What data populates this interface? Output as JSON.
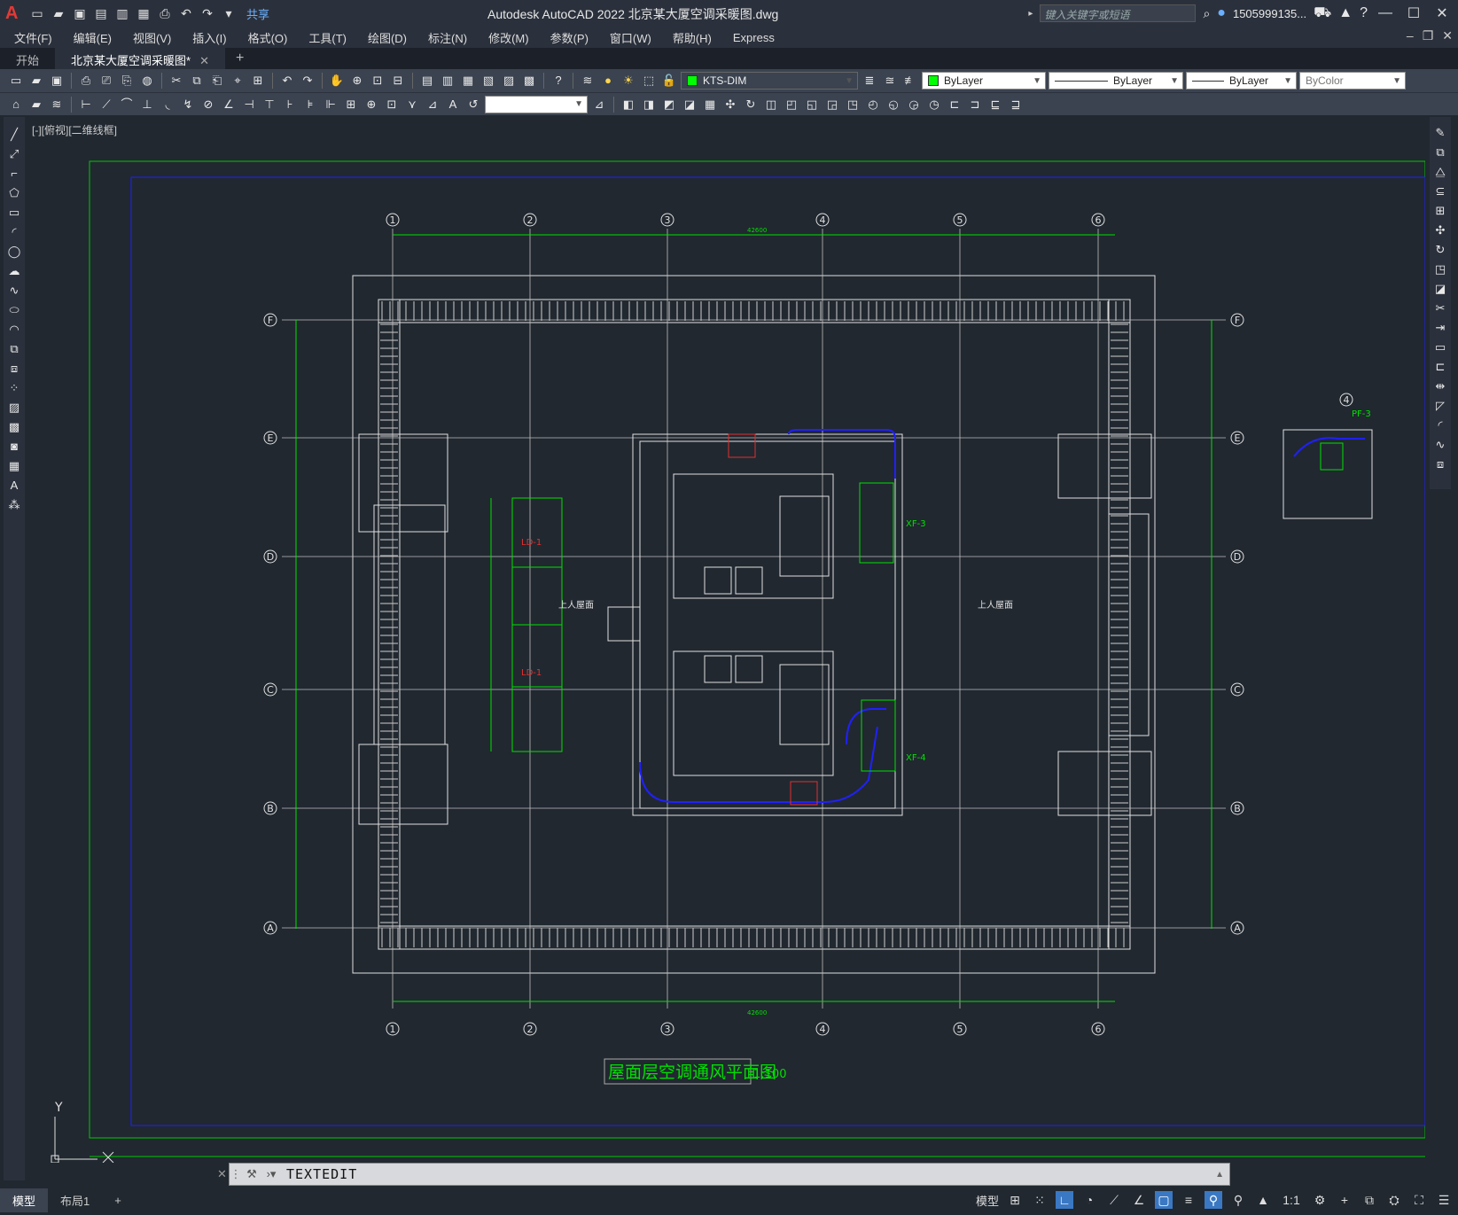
{
  "title_bar": {
    "window_title": "Autodesk AutoCAD 2022    北京某大厦空调采暖图.dwg",
    "share_label": "共享",
    "search_placeholder": "键入关键字或短语",
    "user": "1505999135...",
    "minimize": "—",
    "maximize": "☐",
    "close": "✕"
  },
  "menu": [
    "文件(F)",
    "编辑(E)",
    "视图(V)",
    "插入(I)",
    "格式(O)",
    "工具(T)",
    "绘图(D)",
    "标注(N)",
    "修改(M)",
    "参数(P)",
    "窗口(W)",
    "帮助(H)",
    "Express"
  ],
  "tabs": [
    {
      "label": "开始"
    },
    {
      "label": "北京某大厦空调采暖图*"
    }
  ],
  "toolbar": {
    "layer_name": "KTS-DIM",
    "color": "ByLayer",
    "linetype": "ByLayer",
    "lineweight": "ByLayer",
    "plotstyle": "ByColor",
    "layer_color": "#00ff00"
  },
  "viewport_label": "[-][俯视][二维线框]",
  "drawing": {
    "grid_cols": [
      "1",
      "2",
      "3",
      "4",
      "5",
      "6"
    ],
    "grid_rows": [
      "F",
      "E",
      "D",
      "C",
      "B",
      "A"
    ],
    "plan_title": "屋面层空调通风平面图",
    "scale": "1:100",
    "room_roof_left": "上人屋面",
    "room_roof_right": "上人屋面",
    "ld1": "LD-1",
    "ld1b": "LD-1",
    "xf3": "XF-3",
    "xf4": "XF-4",
    "pf3": "PF-3",
    "dim_total": "42600",
    "axis_y": "Y",
    "axis_x": "X"
  },
  "command": {
    "text": "TEXTEDIT"
  },
  "status": {
    "tabs": [
      "模型",
      "布局1"
    ],
    "model_label": "模型",
    "scale": "1:1"
  }
}
